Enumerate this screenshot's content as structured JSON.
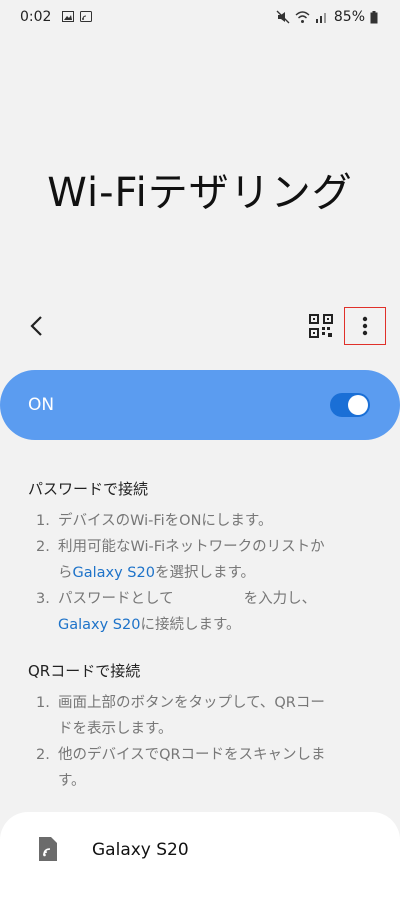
{
  "status_bar": {
    "time": "0:02",
    "battery": "85%"
  },
  "page": {
    "title": "Wi-Fiテザリング"
  },
  "toolbar": {
    "back_icon": "chevron-left-icon",
    "qr_icon": "qr-code-icon",
    "more_icon": "more-vertical-icon",
    "highlight_color": "#e0302a"
  },
  "switch": {
    "label": "ON",
    "state": "on",
    "bar_color": "#5b9cf0"
  },
  "password_section": {
    "title": "パスワードで接続",
    "steps": [
      {
        "num": "1.",
        "text": "デバイスのWi-FiをONにします。"
      },
      {
        "num": "2.",
        "text_a": "利用可能なWi-Fiネットワークのリストか",
        "text_b_pre": "ら",
        "link": "Galaxy S20",
        "text_b_post": "を選択します。"
      },
      {
        "num": "3.",
        "text_a_pre": "パスワードとして",
        "text_a_post": "を入力し、",
        "link": "Galaxy S20",
        "text_b_post": "に接続します。"
      }
    ]
  },
  "qr_section": {
    "title": "QRコードで接続",
    "steps": [
      {
        "num": "1.",
        "line1": "画面上部のボタンをタップして、QRコー",
        "line2": "ドを表示します。"
      },
      {
        "num": "2.",
        "line1": "他のデバイスでQRコードをスキャンしま",
        "line2": "す。"
      }
    ]
  },
  "device_card": {
    "icon": "phone-hotspot-icon",
    "name": "Galaxy S20"
  }
}
